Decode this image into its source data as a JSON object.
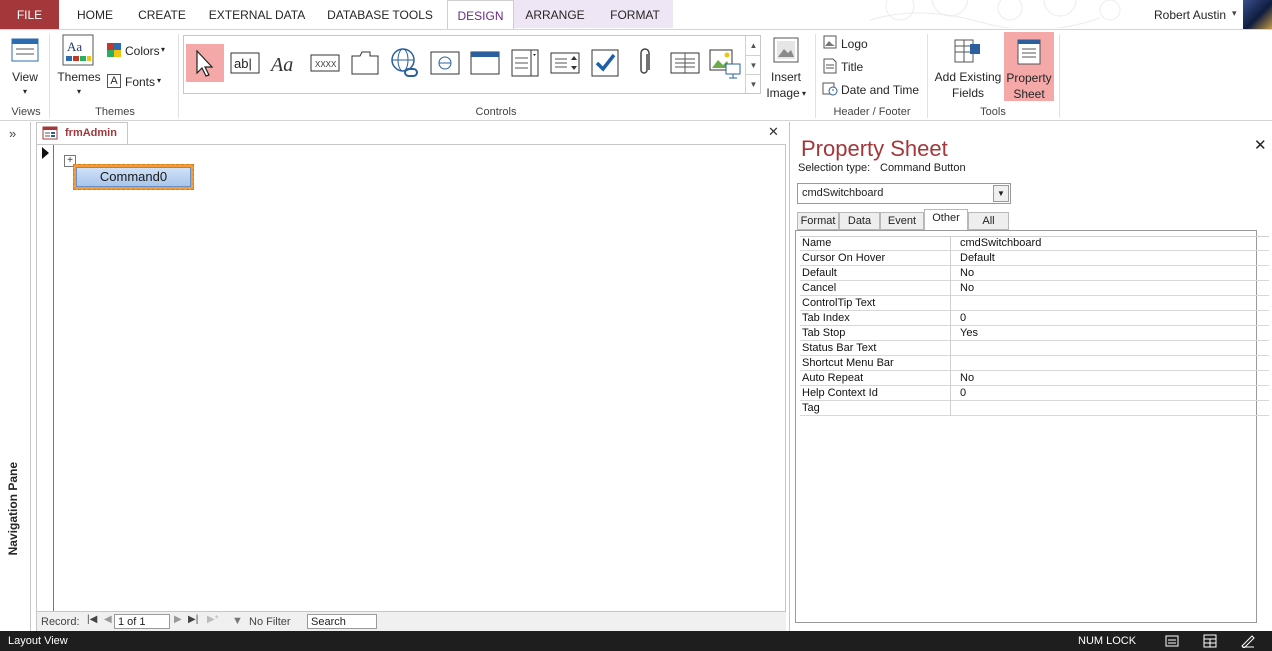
{
  "ribbon_tabs": {
    "file": "FILE",
    "home": "HOME",
    "create": "CREATE",
    "external_data": "EXTERNAL DATA",
    "database_tools": "DATABASE TOOLS",
    "design": "DESIGN",
    "arrange": "ARRANGE",
    "format": "FORMAT"
  },
  "user": {
    "name": "Robert Austin"
  },
  "ribbon": {
    "views": {
      "view_label": "View",
      "group": "Views"
    },
    "themes": {
      "themes_label": "Themes",
      "colors_label": "Colors",
      "fonts_label": "Fonts",
      "group": "Themes"
    },
    "controls": {
      "group": "Controls"
    },
    "insert_image": {
      "line1": "Insert",
      "line2": "Image"
    },
    "header_footer": {
      "logo": "Logo",
      "title": "Title",
      "date_time": "Date and Time",
      "group": "Header / Footer"
    },
    "tools": {
      "add_fields_line1": "Add Existing",
      "add_fields_line2": "Fields",
      "prop_line1": "Property",
      "prop_line2": "Sheet",
      "group": "Tools"
    }
  },
  "nav_pane": {
    "label": "Navigation Pane"
  },
  "document": {
    "tab_label": "frmAdmin",
    "command_button": "Command0"
  },
  "record_bar": {
    "label": "Record:",
    "current": "1 of 1",
    "filter": "No Filter",
    "search": "Search"
  },
  "property_sheet": {
    "title": "Property Sheet",
    "selection_label": "Selection type:",
    "selection_type": "Command Button",
    "object": "cmdSwitchboard",
    "tabs": [
      "Format",
      "Data",
      "Event",
      "Other",
      "All"
    ],
    "active_tab": "Other",
    "rows": [
      {
        "name": "Name",
        "value": "cmdSwitchboard"
      },
      {
        "name": "Cursor On Hover",
        "value": "Default"
      },
      {
        "name": "Default",
        "value": "No"
      },
      {
        "name": "Cancel",
        "value": "No"
      },
      {
        "name": "ControlTip Text",
        "value": ""
      },
      {
        "name": "Tab Index",
        "value": "0"
      },
      {
        "name": "Tab Stop",
        "value": "Yes"
      },
      {
        "name": "Status Bar Text",
        "value": ""
      },
      {
        "name": "Shortcut Menu Bar",
        "value": ""
      },
      {
        "name": "Auto Repeat",
        "value": "No"
      },
      {
        "name": "Help Context Id",
        "value": "0"
      },
      {
        "name": "Tag",
        "value": ""
      }
    ]
  },
  "status_bar": {
    "mode": "Layout View",
    "num_lock": "NUM LOCK"
  },
  "colors": {
    "accent": "#a4373a",
    "context_tab": "#efe6f5",
    "selected_highlight": "#f4a8a8",
    "selection_border": "#f39c3a"
  }
}
